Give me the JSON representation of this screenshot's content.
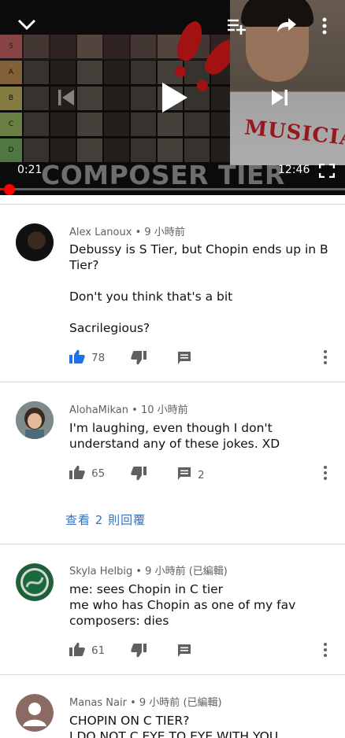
{
  "player": {
    "current_time": "0:21",
    "total_time": "12:46",
    "overlay_title": "COMPOSER TIER LIST",
    "shirt_text": "MUSICIAN",
    "progress": 0.027,
    "tiers": [
      "S",
      "A",
      "B",
      "C",
      "D"
    ],
    "colors": {
      "progress": "#ff0000",
      "like_active": "#1a73e8",
      "link": "#3b6fb5"
    },
    "icons": [
      "collapse-chevron-icon",
      "add-to-playlist-icon",
      "share-icon",
      "more-vert-icon",
      "previous-icon",
      "play-icon",
      "next-icon",
      "fullscreen-icon"
    ]
  },
  "comments": [
    {
      "author": "Alex Lanoux",
      "time": "9 小時前",
      "edited": "",
      "text": "Debussy is S Tier, but Chopin ends up in B Tier?\n\nDon't you think that's a bit\n\nSacrilegious?",
      "likes": "78",
      "replies": "",
      "liked": true
    },
    {
      "author": "AlohaMikan",
      "time": "10 小時前",
      "edited": "",
      "text": "I'm laughing, even though I don't understand any of these jokes. XD",
      "likes": "65",
      "replies": "2",
      "view_replies": "查看 2 則回覆",
      "liked": false
    },
    {
      "author": "Skyla Helbig",
      "time": "9 小時前",
      "edited": "(已編輯)",
      "text": "me: sees Chopin in C tier\nme who has Chopin as one of my fav composers: dies",
      "likes": "61",
      "replies": "",
      "liked": false
    },
    {
      "author": "Manas Nair",
      "time": "9 小時前",
      "edited": "(已編輯)",
      "text": "CHOPIN ON C TIER?\nI DO NOT C EYE TO EYE WITH YOU",
      "likes": "",
      "replies": "",
      "liked": false
    }
  ]
}
